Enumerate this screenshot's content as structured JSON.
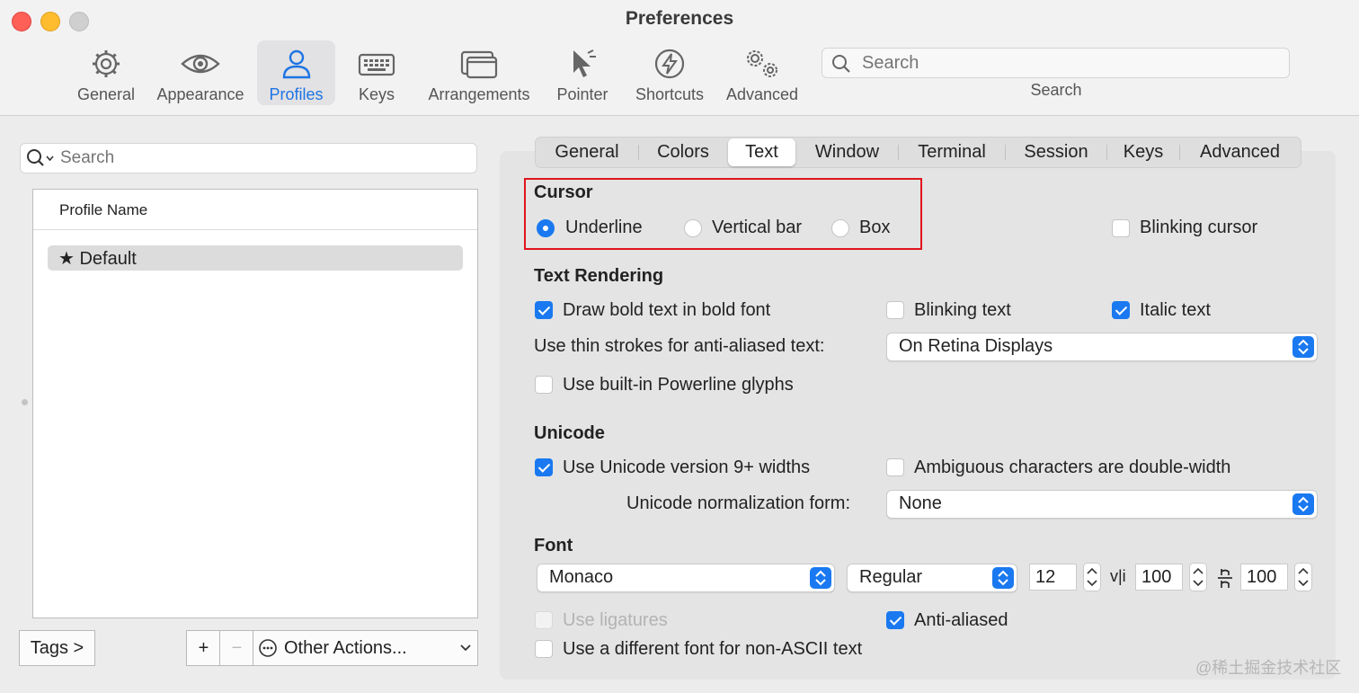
{
  "window": {
    "title": "Preferences"
  },
  "toolbar": {
    "items": [
      {
        "label": "General",
        "icon": "gear-icon"
      },
      {
        "label": "Appearance",
        "icon": "eye-icon"
      },
      {
        "label": "Profiles",
        "icon": "person-icon"
      },
      {
        "label": "Keys",
        "icon": "keyboard-icon"
      },
      {
        "label": "Arrangements",
        "icon": "windows-icon"
      },
      {
        "label": "Pointer",
        "icon": "pointer-icon"
      },
      {
        "label": "Shortcuts",
        "icon": "lightning-icon"
      },
      {
        "label": "Advanced",
        "icon": "gears-icon"
      }
    ],
    "active": "Profiles",
    "search_placeholder": "Search",
    "search_label": "Search"
  },
  "sidebar": {
    "search_placeholder": "Search",
    "column_header": "Profile Name",
    "profiles": [
      {
        "name": "★ Default"
      }
    ],
    "tags_button": "Tags >",
    "add_button": "+",
    "remove_button": "−",
    "other_actions": "Other Actions..."
  },
  "tabs": {
    "items": [
      "General",
      "Colors",
      "Text",
      "Window",
      "Terminal",
      "Session",
      "Keys",
      "Advanced"
    ],
    "selected": "Text"
  },
  "cursor": {
    "heading": "Cursor",
    "options": [
      "Underline",
      "Vertical bar",
      "Box"
    ],
    "selected": "Underline",
    "blinking_label": "Blinking cursor",
    "blinking": false
  },
  "text_rendering": {
    "heading": "Text Rendering",
    "bold_label": "Draw bold text in bold font",
    "bold": true,
    "blinking_text_label": "Blinking text",
    "blinking_text": false,
    "italic_label": "Italic text",
    "italic": true,
    "thin_strokes_label": "Use thin strokes for anti-aliased text:",
    "thin_strokes_value": "On Retina Displays",
    "powerline_label": "Use built-in Powerline glyphs",
    "powerline": false
  },
  "unicode": {
    "heading": "Unicode",
    "v9_label": "Use Unicode version 9+ widths",
    "v9": true,
    "ambiguous_label": "Ambiguous characters are double-width",
    "ambiguous": false,
    "normalization_label": "Unicode normalization form:",
    "normalization_value": "None"
  },
  "font": {
    "heading": "Font",
    "family": "Monaco",
    "style": "Regular",
    "size": "12",
    "vertical_spacing_icon": "v|i",
    "vertical_spacing": "100",
    "horizontal_spacing": "100",
    "ligatures_label": "Use ligatures",
    "ligatures": false,
    "antialiased_label": "Anti-aliased",
    "antialiased": true,
    "non_ascii_label": "Use a different font for non-ASCII text",
    "non_ascii": false
  },
  "watermark": "@稀土掘金技术社区",
  "colors": {
    "accent": "#1a79f0",
    "highlight_box": "#e0141c"
  }
}
